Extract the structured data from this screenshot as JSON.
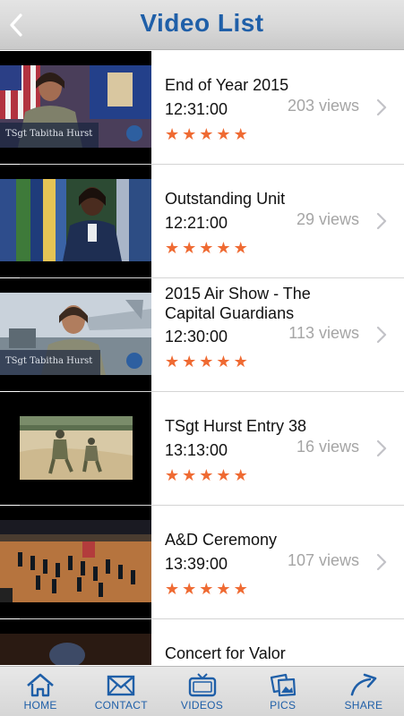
{
  "header": {
    "title": "Video List"
  },
  "videos": [
    {
      "title": "End of Year   2015",
      "duration": "12:31:00",
      "views": "203 views",
      "rating": 5,
      "thumb_caption": "TSgt Tabitha Hurst"
    },
    {
      "title": "Outstanding Unit",
      "duration": "12:21:00",
      "views": "29 views",
      "rating": 5
    },
    {
      "title": "2015 Air Show - The Capital Guardians",
      "duration": "12:30:00",
      "views": "113 views",
      "rating": 5,
      "thumb_caption": "TSgt Tabitha Hurst"
    },
    {
      "title": "TSgt Hurst Entry 38",
      "duration": "13:13:00",
      "views": "16 views",
      "rating": 5
    },
    {
      "title": "A&D Ceremony",
      "duration": "13:39:00",
      "views": "107 views",
      "rating": 5
    },
    {
      "title": "Concert for Valor"
    }
  ],
  "tabs": [
    {
      "label": "HOME",
      "icon": "home-icon"
    },
    {
      "label": "CONTACT",
      "icon": "envelope-icon"
    },
    {
      "label": "VIDEOS",
      "icon": "tv-icon"
    },
    {
      "label": "PICS",
      "icon": "photos-icon"
    },
    {
      "label": "SHARE",
      "icon": "share-arrow-icon"
    }
  ],
  "colors": {
    "accent": "#1f5fa8",
    "star": "#ef6a32",
    "views": "#a5a5a5"
  }
}
